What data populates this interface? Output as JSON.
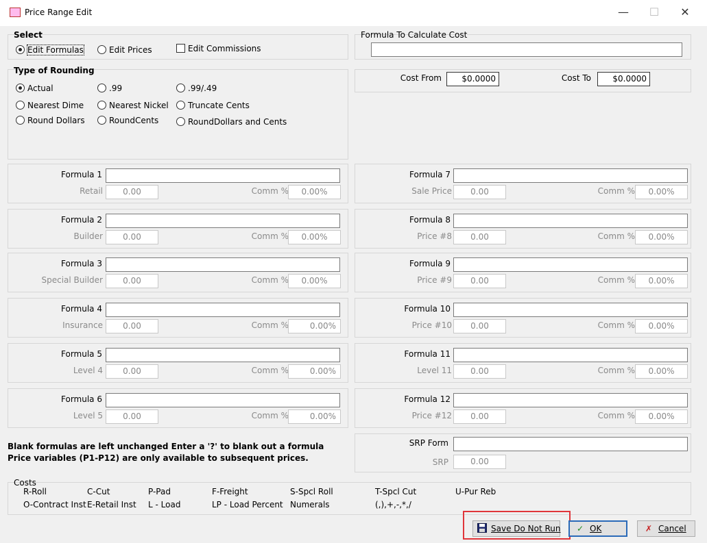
{
  "window": {
    "title": "Price Range Edit",
    "minimize": "—",
    "maximize": "☐",
    "close": "✕"
  },
  "select": {
    "title": "Select",
    "options": [
      {
        "label": "Edit Formulas",
        "selected": true
      },
      {
        "label": "Edit Prices",
        "selected": false
      }
    ],
    "edit_commissions": {
      "label": "Edit Commissions",
      "checked": false
    }
  },
  "rounding": {
    "title": "Type of Rounding",
    "options": [
      {
        "label": "Actual",
        "selected": true
      },
      {
        "label": ".99",
        "selected": false
      },
      {
        "label": ".99/.49",
        "selected": false
      },
      {
        "label": "Nearest Dime",
        "selected": false
      },
      {
        "label": "Nearest Nickel",
        "selected": false
      },
      {
        "label": "Truncate Cents",
        "selected": false
      },
      {
        "label": "Round Dollars",
        "selected": false
      },
      {
        "label": "RoundCents",
        "selected": false
      },
      {
        "label": "RoundDollars and Cents",
        "selected": false
      }
    ]
  },
  "cost_formula": {
    "title": "Formula To Calculate Cost",
    "value": ""
  },
  "cost_range": {
    "from_label": "Cost From",
    "from_value": "$0.0000",
    "to_label": "Cost To",
    "to_value": "$0.0000"
  },
  "formulas": [
    {
      "label": "Formula 1",
      "value": "",
      "price_label": "Retail",
      "price": "0.00",
      "comm_label": "Comm %",
      "comm": "0.00%"
    },
    {
      "label": "Formula 2",
      "value": "",
      "price_label": "Builder",
      "price": "0.00",
      "comm_label": "Comm %",
      "comm": "0.00%"
    },
    {
      "label": "Formula 3",
      "value": "",
      "price_label": "Special Builder",
      "price": "0.00",
      "comm_label": "Comm %",
      "comm": "0.00%"
    },
    {
      "label": "Formula 4",
      "value": "",
      "price_label": "Insurance",
      "price": "0.00",
      "comm_label": "Comm %",
      "comm": "0.00%"
    },
    {
      "label": "Formula 5",
      "value": "",
      "price_label": "Level 4",
      "price": "0.00",
      "comm_label": "Comm %",
      "comm": "0.00%"
    },
    {
      "label": "Formula 6",
      "value": "",
      "price_label": "Level 5",
      "price": "0.00",
      "comm_label": "Comm %",
      "comm": "0.00%"
    },
    {
      "label": "Formula 7",
      "value": "",
      "price_label": "Sale Price",
      "price": "0.00",
      "comm_label": "Comm %",
      "comm": "0.00%"
    },
    {
      "label": "Formula 8",
      "value": "",
      "price_label": "Price #8",
      "price": "0.00",
      "comm_label": "Comm %",
      "comm": "0.00%"
    },
    {
      "label": "Formula 9",
      "value": "",
      "price_label": "Price #9",
      "price": "0.00",
      "comm_label": "Comm %",
      "comm": "0.00%"
    },
    {
      "label": "Formula 10",
      "value": "",
      "price_label": "Price #10",
      "price": "0.00",
      "comm_label": "Comm %",
      "comm": "0.00%"
    },
    {
      "label": "Formula 11",
      "value": "",
      "price_label": "Level 11",
      "price": "0.00",
      "comm_label": "Comm %",
      "comm": "0.00%"
    },
    {
      "label": "Formula 12",
      "value": "",
      "price_label": "Price #12",
      "price": "0.00",
      "comm_label": "Comm %",
      "comm": "0.00%"
    }
  ],
  "srp": {
    "label": "SRP Form",
    "value": "",
    "price_label": "SRP",
    "price": "0.00"
  },
  "notes": {
    "line1": "Blank formulas are left unchanged  Enter a '?' to blank out a formula",
    "line2": "Price variables (P1-P12) are only available to subsequent prices."
  },
  "costs": {
    "title": "Costs",
    "row1": [
      "R-Roll",
      "C-Cut",
      "P-Pad",
      "F-Freight",
      "S-Spcl Roll",
      "T-Spcl Cut",
      "U-Pur Reb"
    ],
    "row2": [
      "O-Contract Inst",
      "E-Retail Inst",
      "L - Load",
      "LP - Load Percent",
      "Numerals",
      "(,),+,-,*,/"
    ]
  },
  "buttons": {
    "save": "Save Do Not Run",
    "ok": "OK",
    "cancel": "Cancel"
  },
  "colors": {
    "highlight": "#e0353a",
    "focus_border": "#2a6ab8"
  }
}
